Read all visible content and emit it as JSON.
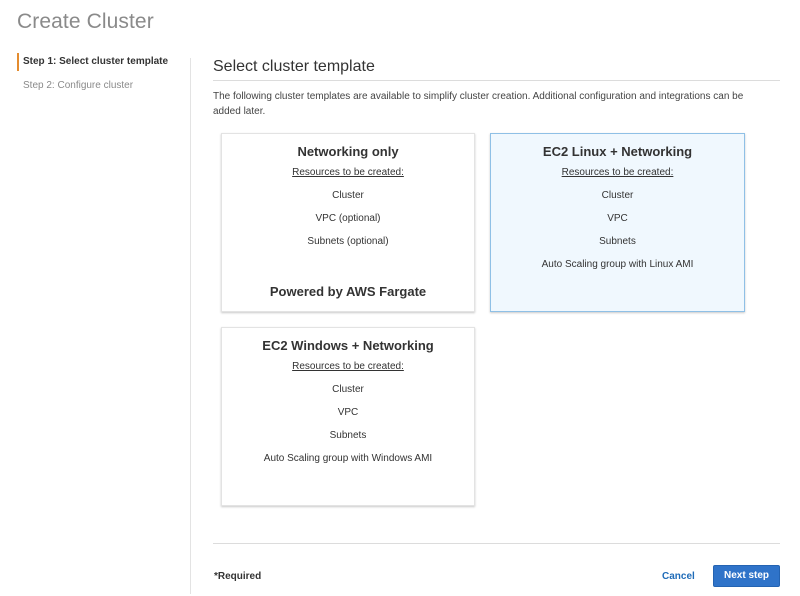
{
  "page": {
    "title": "Create Cluster"
  },
  "sidebar": {
    "steps": [
      {
        "label": "Step 1: Select cluster template",
        "active": true
      },
      {
        "label": "Step 2: Configure cluster",
        "active": false
      }
    ]
  },
  "main": {
    "section_title": "Select cluster template",
    "description": "The following cluster templates are available to simplify cluster creation. Additional configuration and integrations can be added later.",
    "templates": [
      {
        "title": "Networking only",
        "resources_label": "Resources to be created:",
        "resources": [
          "Cluster",
          "VPC (optional)",
          "Subnets (optional)"
        ],
        "footer": "Powered by AWS Fargate",
        "selected": false
      },
      {
        "title": "EC2 Linux + Networking",
        "resources_label": "Resources to be created:",
        "resources": [
          "Cluster",
          "VPC",
          "Subnets",
          "Auto Scaling group with Linux AMI"
        ],
        "footer": "",
        "selected": true
      },
      {
        "title": "EC2 Windows + Networking",
        "resources_label": "Resources to be created:",
        "resources": [
          "Cluster",
          "VPC",
          "Subnets",
          "Auto Scaling group with Windows AMI"
        ],
        "footer": "",
        "selected": false
      }
    ]
  },
  "footer": {
    "required_note": "*Required",
    "cancel_label": "Cancel",
    "next_label": "Next step"
  },
  "colors": {
    "accent_step": "#e48c2f",
    "selected_card_bg": "#f0f8fe",
    "selected_card_border": "#8fc0e6",
    "primary_button": "#2f73c9",
    "link": "#1e6bb8"
  }
}
